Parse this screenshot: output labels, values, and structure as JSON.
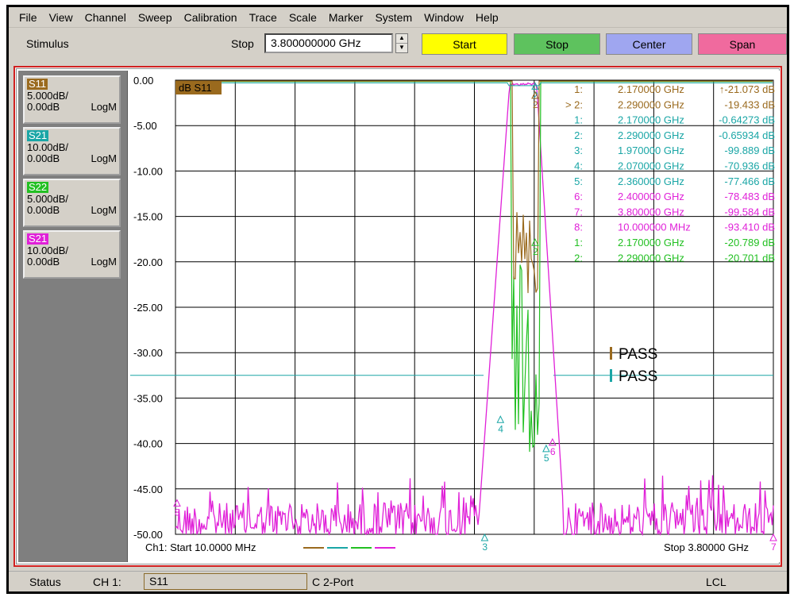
{
  "menu": [
    "File",
    "View",
    "Channel",
    "Sweep",
    "Calibration",
    "Trace",
    "Scale",
    "Marker",
    "System",
    "Window",
    "Help"
  ],
  "toolbar": {
    "stimulus_label": "Stimulus",
    "stop_label": "Stop",
    "stop_value": "3.800000000 GHz",
    "buttons": [
      {
        "label": "Start",
        "color": "#ffff00"
      },
      {
        "label": "Stop",
        "color": "#5ec25e"
      },
      {
        "label": "Center",
        "color": "#9fa6f0"
      },
      {
        "label": "Span",
        "color": "#f06a9e"
      }
    ]
  },
  "traces": [
    {
      "name": "S11",
      "scale": "5.000dB/",
      "ref": "0.00dB",
      "format": "LogM",
      "color": "#9a6a1e",
      "text_color": "#ffffff"
    },
    {
      "name": "S21",
      "scale": "10.00dB/",
      "ref": "0.00dB",
      "format": "LogM",
      "color": "#1aa6a6",
      "text_color": "#ffffff"
    },
    {
      "name": "S22",
      "scale": "5.000dB/",
      "ref": "0.00dB",
      "format": "LogM",
      "color": "#22c022",
      "text_color": "#ffffff"
    },
    {
      "name": "S21",
      "scale": "10.00dB/",
      "ref": "0.00dB",
      "format": "LogM",
      "color": "#e020d8",
      "text_color": "#ffffff"
    }
  ],
  "plot": {
    "active_label": "dB S11",
    "y_ticks": [
      "0.00",
      "-5.00",
      "-10.00",
      "-15.00",
      "-20.00",
      "-25.00",
      "-30.00",
      "-35.00",
      "-40.00",
      "-45.00",
      "-50.00"
    ],
    "x_start": "Ch1: Start  10.0000 MHz",
    "x_stop": "Stop  3.80000 GHz",
    "pass_labels": [
      {
        "text": "PASS",
        "color": "#9a6a1e"
      },
      {
        "text": "PASS",
        "color": "#1aa6a6"
      }
    ],
    "marker_table": [
      {
        "id": "1:",
        "freq": "2.170000 GHz",
        "val": "-21.073 dB",
        "color": "#9a6a1e",
        "arrow": "↑"
      },
      {
        "id": "> 2:",
        "freq": "2.290000 GHz",
        "val": "-19.433 dB",
        "color": "#9a6a1e",
        "arrow": ""
      },
      {
        "id": "1:",
        "freq": "2.170000 GHz",
        "val": "-0.64273 dB",
        "color": "#1aa6a6",
        "arrow": ""
      },
      {
        "id": "2:",
        "freq": "2.290000 GHz",
        "val": "-0.65934 dB",
        "color": "#1aa6a6",
        "arrow": ""
      },
      {
        "id": "3:",
        "freq": "1.970000 GHz",
        "val": "-99.889 dB",
        "color": "#1aa6a6",
        "arrow": ""
      },
      {
        "id": "4:",
        "freq": "2.070000 GHz",
        "val": "-70.936 dB",
        "color": "#1aa6a6",
        "arrow": ""
      },
      {
        "id": "5:",
        "freq": "2.360000 GHz",
        "val": "-77.466 dB",
        "color": "#1aa6a6",
        "arrow": ""
      },
      {
        "id": "6:",
        "freq": "2.400000 GHz",
        "val": "-78.483 dB",
        "color": "#e020d8",
        "arrow": ""
      },
      {
        "id": "7:",
        "freq": "3.800000 GHz",
        "val": "-99.584 dB",
        "color": "#e020d8",
        "arrow": ""
      },
      {
        "id": "8:",
        "freq": "10.000000 MHz",
        "val": "-93.410 dB",
        "color": "#e020d8",
        "arrow": ""
      },
      {
        "id": "1:",
        "freq": "2.170000 GHz",
        "val": "-20.789 dB",
        "color": "#22c022",
        "arrow": ""
      },
      {
        "id": "2:",
        "freq": "2.290000 GHz",
        "val": "-20.701 dB",
        "color": "#22c022",
        "arrow": ""
      }
    ],
    "marker_flags": [
      {
        "label": "2",
        "color": "#1aa6a6"
      },
      {
        "label": "2",
        "color": "#9a6a1e"
      },
      {
        "label": "3",
        "color": "#1aa6a6"
      },
      {
        "label": "4",
        "color": "#1aa6a6"
      },
      {
        "label": "5",
        "color": "#1aa6a6"
      },
      {
        "label": "6",
        "color": "#e020d8"
      },
      {
        "label": "7",
        "color": "#e020d8"
      },
      {
        "label": "8",
        "color": "#e020d8"
      },
      {
        "label": "2",
        "color": "#22c022"
      }
    ]
  },
  "status": {
    "label": "Status",
    "channel": "CH 1:",
    "trace": "S11",
    "port": "C  2-Port",
    "mode": "LCL"
  },
  "colors": {
    "grid": "#000000",
    "limit_line": "#1aa6a6",
    "s11": "#9a6a1e",
    "s21": "#1aa6a6",
    "s22": "#22c022",
    "s21b": "#e020d8"
  }
}
